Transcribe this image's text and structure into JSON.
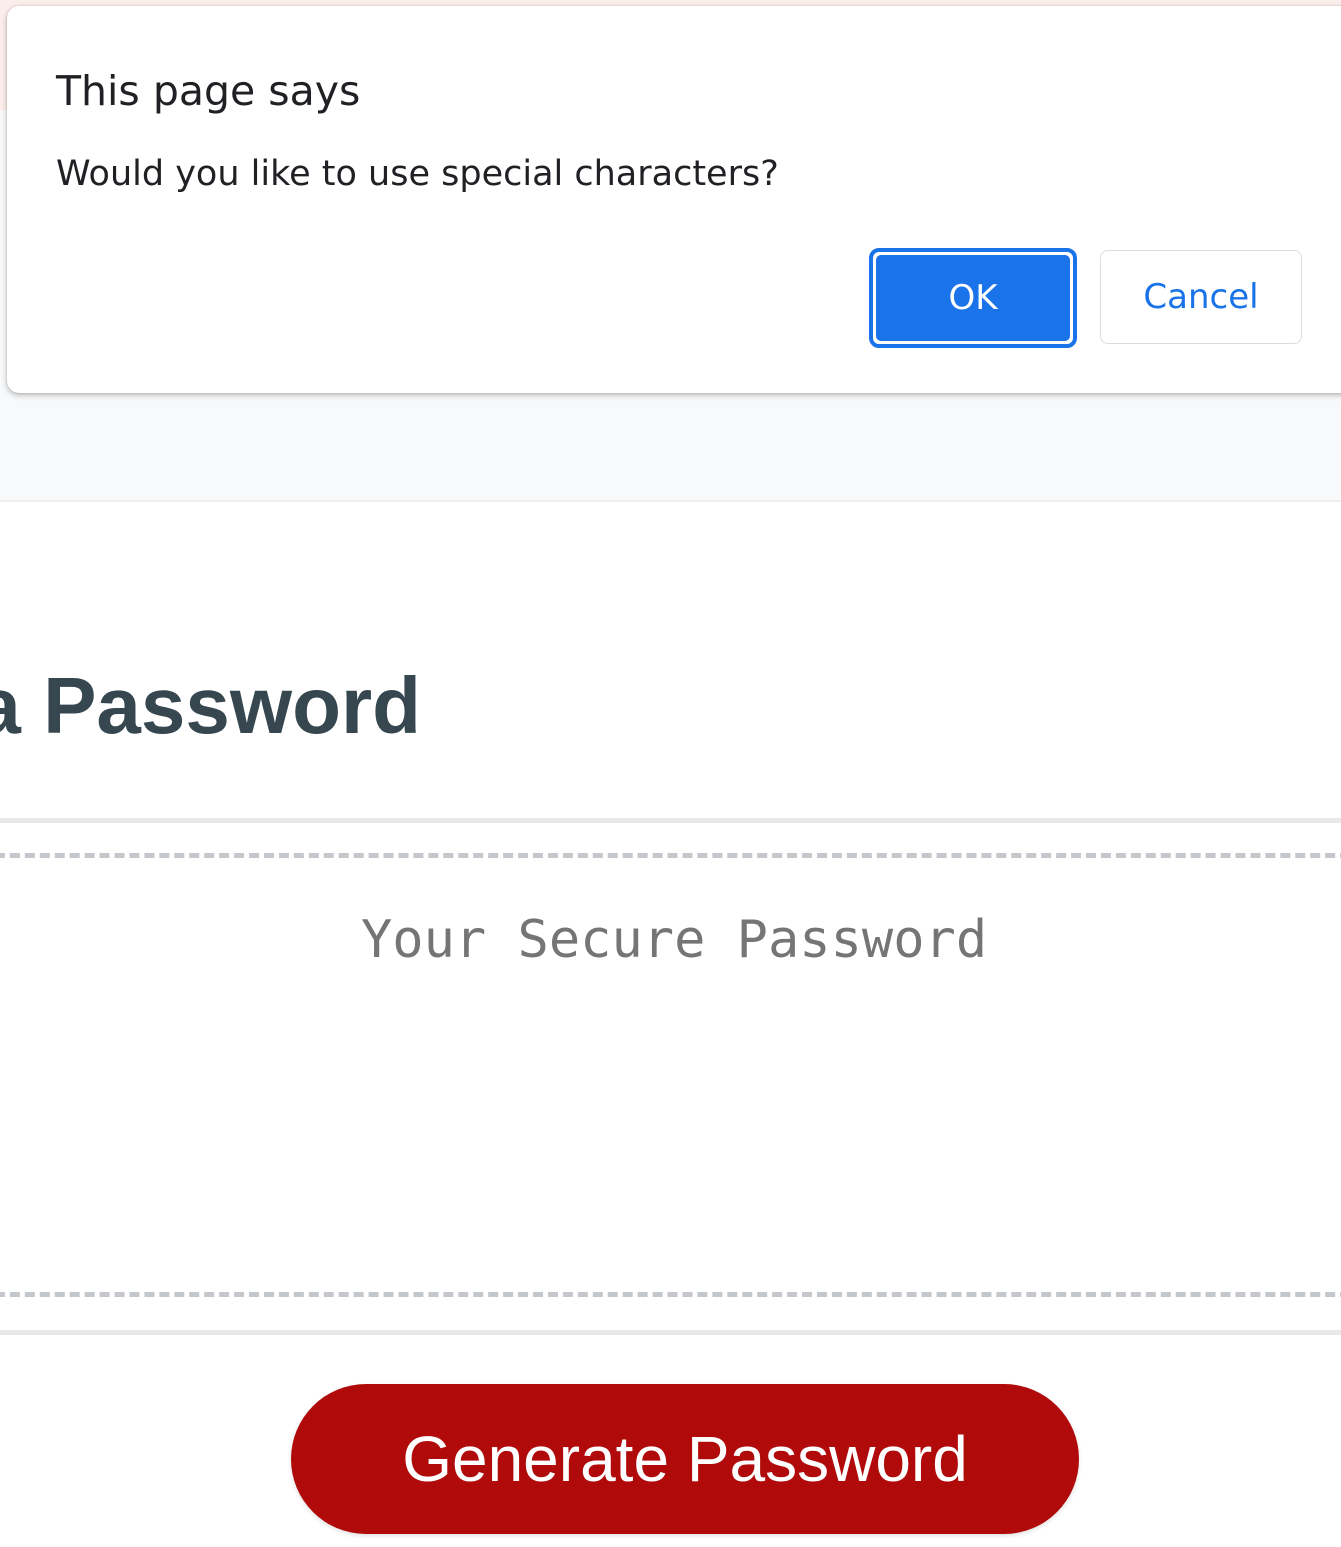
{
  "dialog": {
    "title": "This page says",
    "message": "Would you like to use special characters?",
    "ok_label": "OK",
    "cancel_label": "Cancel"
  },
  "page": {
    "heading": "a Password",
    "password_placeholder": "Your Secure Password",
    "generate_label": "Generate Password"
  },
  "colors": {
    "accent_blue": "#1a73e8",
    "generate_button": "#b00a0a",
    "heading_text": "#37474f"
  }
}
